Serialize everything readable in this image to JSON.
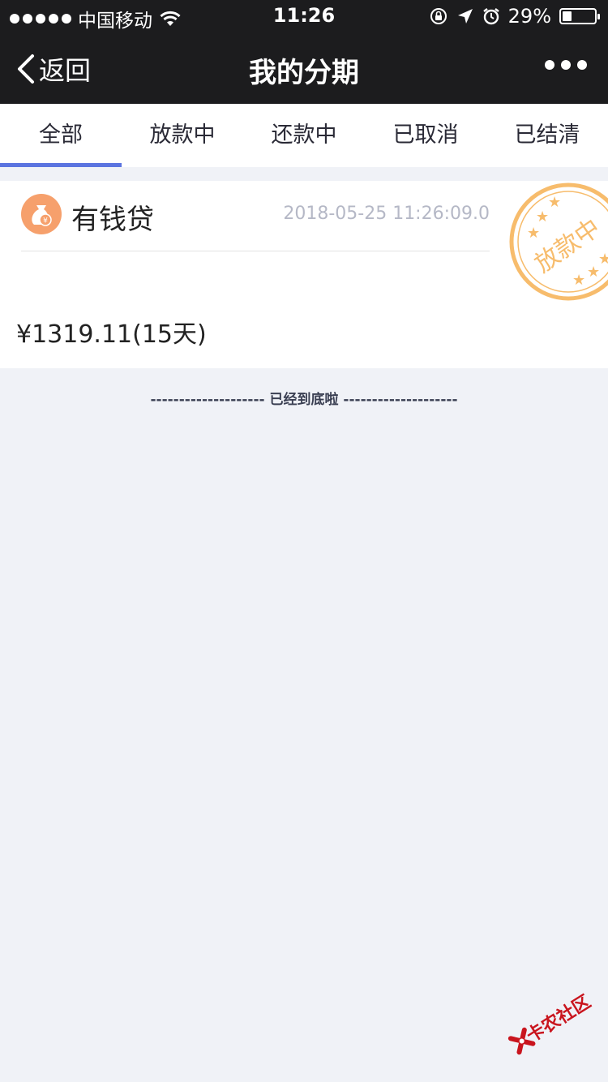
{
  "status_bar": {
    "carrier": "中国移动",
    "time": "11:26",
    "battery_percent": "29%",
    "battery_level": 0.29,
    "icons": [
      "signal-dots",
      "wifi-icon",
      "orientation-lock-icon",
      "location-arrow-icon",
      "alarm-icon",
      "battery-icon"
    ]
  },
  "nav": {
    "back_label": "返回",
    "title": "我的分期",
    "more_icon": "more-dots-icon"
  },
  "tabs": [
    {
      "label": "全部",
      "active": true
    },
    {
      "label": "放款中",
      "active": false
    },
    {
      "label": "还款中",
      "active": false
    },
    {
      "label": "已取消",
      "active": false
    },
    {
      "label": "已结清",
      "active": false
    }
  ],
  "loan_card": {
    "icon": "money-bag-icon",
    "product_name": "有钱贷",
    "timestamp": "2018-05-25 11:26:09.0",
    "amount": "¥1319.11(15天)",
    "stamp_text": "放款中",
    "stamp_color": "#f7bc6c"
  },
  "list_end_text": "-------------------- 已经到底啦 --------------------",
  "watermark": {
    "text": "卡农社区",
    "color": "#c9151e"
  },
  "colors": {
    "nav_background": "#1c1c1e",
    "tab_accent": "#5b74e0",
    "page_background": "#f0f2f7",
    "icon_orange": "#f6a06c"
  }
}
